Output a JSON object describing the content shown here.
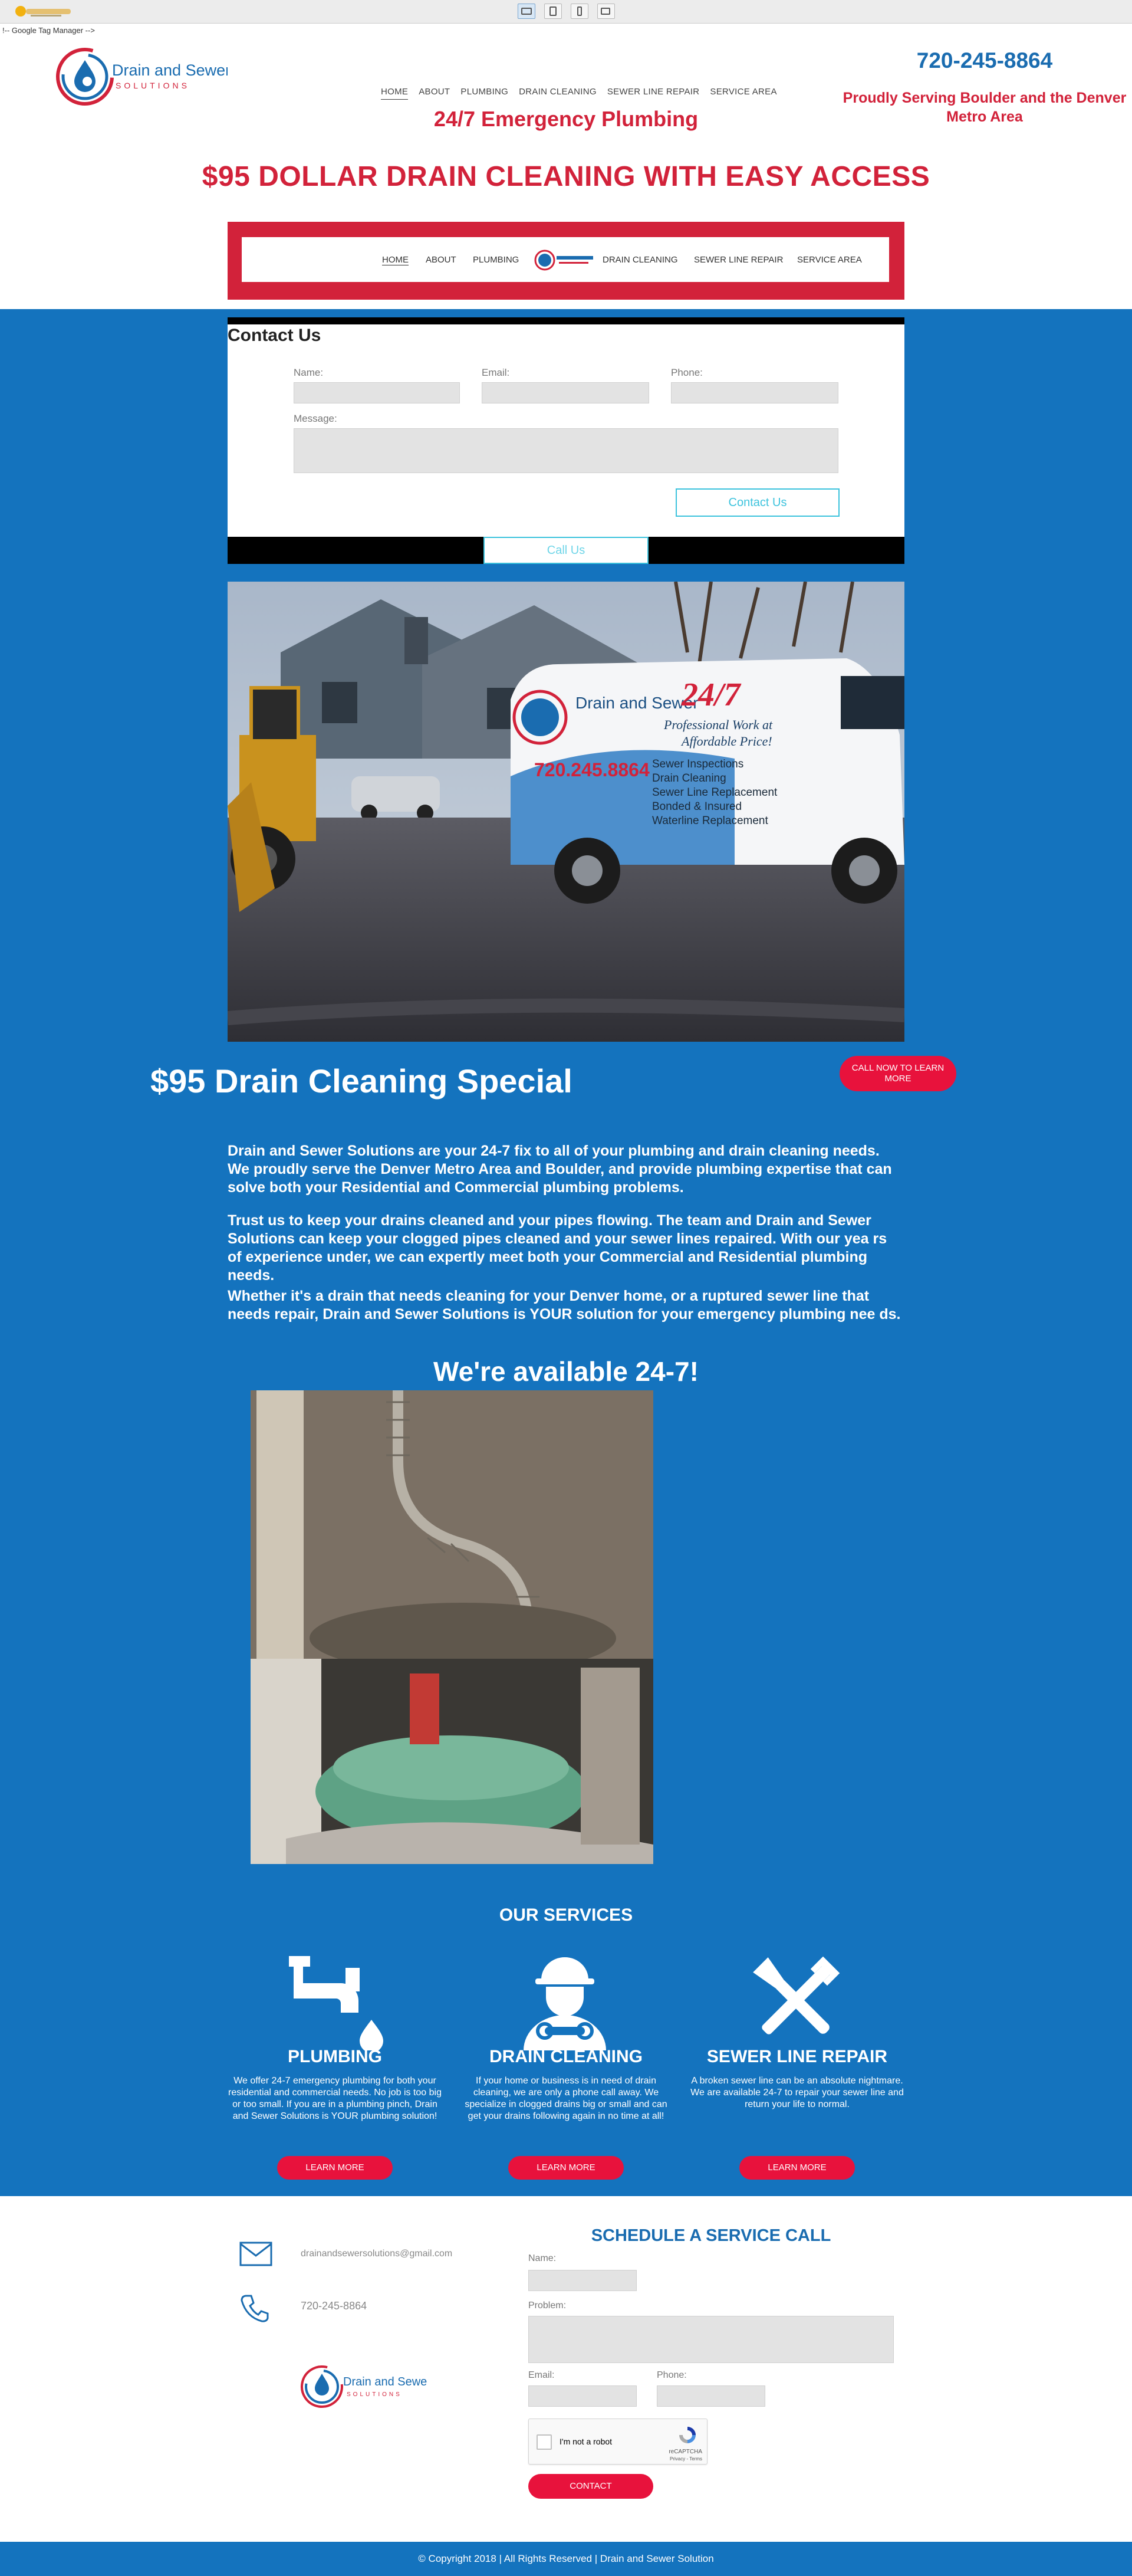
{
  "gtm_comment": "!-- Google Tag Manager -->",
  "header": {
    "logo_line1": "Drain and Sewer",
    "logo_line2": "SOLUTIONS",
    "nav": [
      "HOME",
      "ABOUT",
      "PLUMBING",
      "DRAIN CLEANING",
      "SEWER LINE REPAIR",
      "SERVICE AREA"
    ],
    "phone": "720-245-8864",
    "serving": "Proudly Serving Boulder and the Denver Metro Area",
    "emergency": "24/7 Emergency Plumbing"
  },
  "promo": {
    "headline": "$95 DOLLAR DRAIN CLEANING WITH EASY ACCESS"
  },
  "frame_nav": [
    "HOME",
    "ABOUT",
    "PLUMBING",
    "DRAIN CLEANING",
    "SEWER LINE REPAIR",
    "SERVICE AREA"
  ],
  "contact_form": {
    "title": "Contact Us",
    "name_label": "Name:",
    "email_label": "Email:",
    "phone_label": "Phone:",
    "message_label": "Message:",
    "submit": "Contact Us",
    "call_us": "Call Us"
  },
  "van_photo": {
    "van_big": "24/7",
    "van_tagline1": "Professional Work at",
    "van_tagline2": "Affordable Price!",
    "van_phone": "720.245.8864",
    "van_services": [
      "Sewer Inspections",
      "Drain Cleaning",
      "Sewer Line Replacement",
      "Bonded & Insured",
      "Waterline Replacement"
    ]
  },
  "special": {
    "title": "$95 Drain Cleaning Special",
    "button": "CALL NOW TO LEARN MORE",
    "paragraphs": [
      "Drain and Sewer Solutions are your 24-7 fix to all of your plumbing and drain cleaning needs.  We proudly serve the Denver Metro Area and Boulder, and provide plumbing expertise that can solve both your Residential and Commercial plumbing problems.",
      "Trust us to keep your drains cleaned and your pipes flowing.  The team and Drain and Sewer Solutions can keep your clogged pipes cleaned and your sewer lines repaired.  With our yea rs of experience under, we can expertly meet both your Commercial and Residential plumbing needs.",
      "Whether it's a drain that needs cleaning for your Denver home, or a ruptured sewer line that needs repair, Drain and Sewer Solutions is YOUR solution for your emergency plumbing nee ds."
    ],
    "available": "We're available 24-7!"
  },
  "services": {
    "title": "OUR SERVICES",
    "items": [
      {
        "title": "PLUMBING",
        "text": "We offer 24-7 emergency plumbing for both your residential and commercial needs.  No job is too big or too small.  If you are in a plumbing pinch, Drain and Sewer Solutions is YOUR plumbing solution!",
        "button": "LEARN MORE",
        "icon": "faucet-icon"
      },
      {
        "title": "DRAIN CLEANING",
        "text": "If your home or business is in need of drain cleaning, we are only a phone call away.  We specialize in clogged drains big or small and can get your drains following again in no time at all!",
        "button": "LEARN MORE",
        "icon": "plumber-icon"
      },
      {
        "title": "SEWER LINE REPAIR",
        "text": "A broken sewer line can be an absolute nightmare.  We are available 24-7 to repair your sewer line and return your life to normal.",
        "button": "LEARN MORE",
        "icon": "tools-icon"
      }
    ]
  },
  "footer_contact": {
    "email": "drainandsewersolutions@gmail.com",
    "phone": "720-245-8864",
    "schedule_title": "SCHEDULE A SERVICE CALL",
    "name_label": "Name:",
    "problem_label": "Problem:",
    "email_label": "Email:",
    "phone_label": "Phone:",
    "recaptcha_label": "I'm not a robot",
    "recaptcha_brand": "reCAPTCHA",
    "recaptcha_terms": "Privacy - Terms",
    "contact_button": "CONTACT"
  },
  "copyright": "© Copyright 2018 | All Rights Reserved | Drain and Sewer Solution",
  "colors": {
    "brand_blue": "#1473be",
    "brand_red": "#d2223a",
    "button_red": "#e8123c",
    "accent_cyan": "#3dc3dd"
  }
}
